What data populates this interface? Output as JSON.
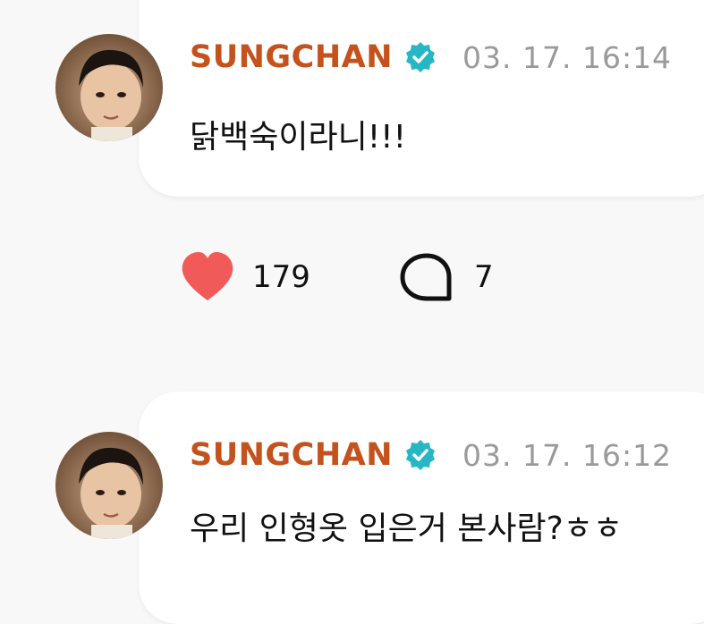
{
  "posts": [
    {
      "author": "SUNGCHAN",
      "timestamp": "03. 17. 16:14",
      "message": "닭백숙이라니!!!",
      "likes": "179",
      "comments": "7"
    },
    {
      "author": "SUNGCHAN",
      "timestamp": "03. 17. 16:12",
      "message": "우리 인형옷 입은거 본사람?ㅎㅎ"
    }
  ],
  "colors": {
    "author": "#c4521d",
    "verified_badge": "#27b6c4",
    "heart": "#f25a5a",
    "timestamp": "#9a9a9a"
  },
  "icons": {
    "verified": "verified-badge-icon",
    "like": "heart-icon",
    "comment": "comment-bubble-icon"
  }
}
